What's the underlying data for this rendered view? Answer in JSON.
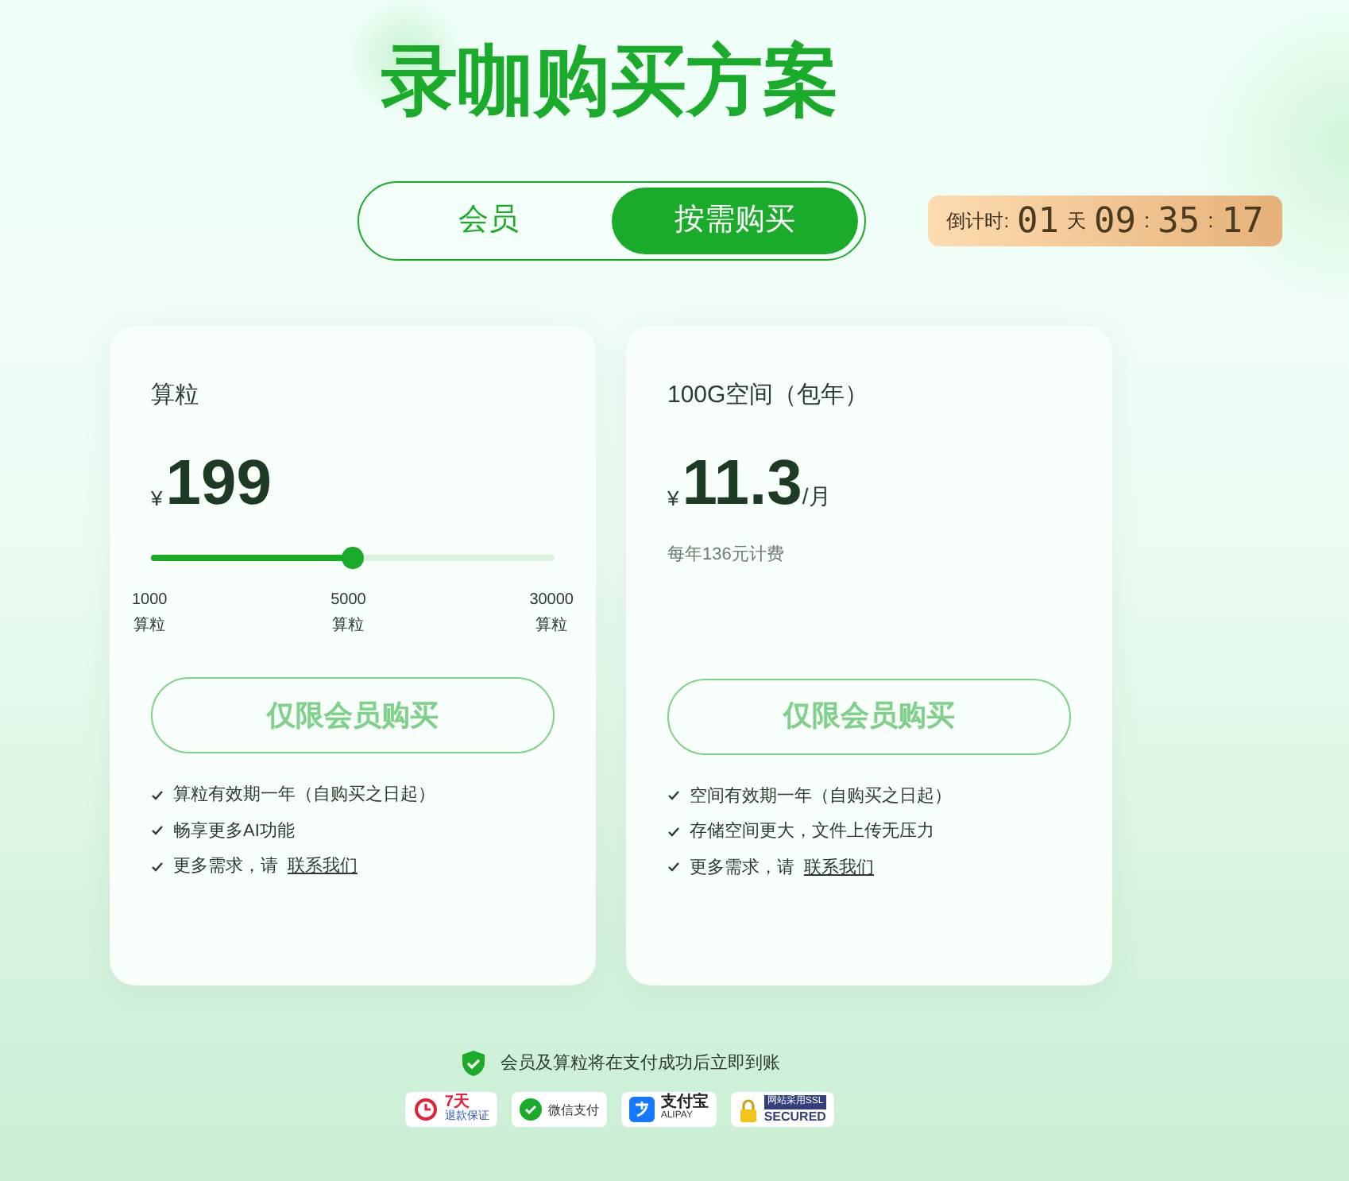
{
  "title": "录咖购买方案",
  "tabs": [
    {
      "label": "会员",
      "selected": false
    },
    {
      "label": "按需购买",
      "selected": true
    }
  ],
  "countdown": {
    "label": "倒计时:",
    "days": "01",
    "day_unit": "天",
    "hours": "09",
    "sep1": ":",
    "minutes": "35",
    "sep2": ":",
    "seconds": "17"
  },
  "cards": [
    {
      "kind": "slider",
      "name": "算粒",
      "currency": "¥",
      "price": "199",
      "slider": {
        "level": 0.5,
        "ticks": [
          {
            "value": "1000",
            "unit": "算粒"
          },
          {
            "value": "5000",
            "unit": "算粒"
          },
          {
            "value": "30000",
            "unit": "算粒"
          }
        ]
      },
      "button": "仅限会员购买",
      "features": [
        {
          "text": "算粒有效期一年（自购买之日起）"
        },
        {
          "text": "畅享更多AI功能"
        },
        {
          "text": "更多需求，请",
          "link": "联系我们"
        }
      ]
    },
    {
      "kind": "plan",
      "name": "100G空间（包年）",
      "currency": "¥",
      "price": "11.3",
      "unit": "/月",
      "note": "每年136元计费",
      "button": "仅限会员购买",
      "features": [
        {
          "text": "空间有效期一年（自购买之日起）"
        },
        {
          "text": "存储空间更大，文件上传无压力"
        },
        {
          "text": "更多需求，请",
          "link": "联系我们"
        }
      ]
    }
  ],
  "footer": {
    "note": "会员及算粒将在支付成功后立即到账",
    "badges": [
      {
        "kind": "refund",
        "top": "7天",
        "bottom": "退款保证"
      },
      {
        "kind": "wechat",
        "top": "微信支付"
      },
      {
        "kind": "alipay",
        "top": "支付宝",
        "bottom": "ALIPAY"
      },
      {
        "kind": "ssl",
        "top": "网站采用SSL",
        "bottom": "SECURED"
      }
    ]
  }
}
